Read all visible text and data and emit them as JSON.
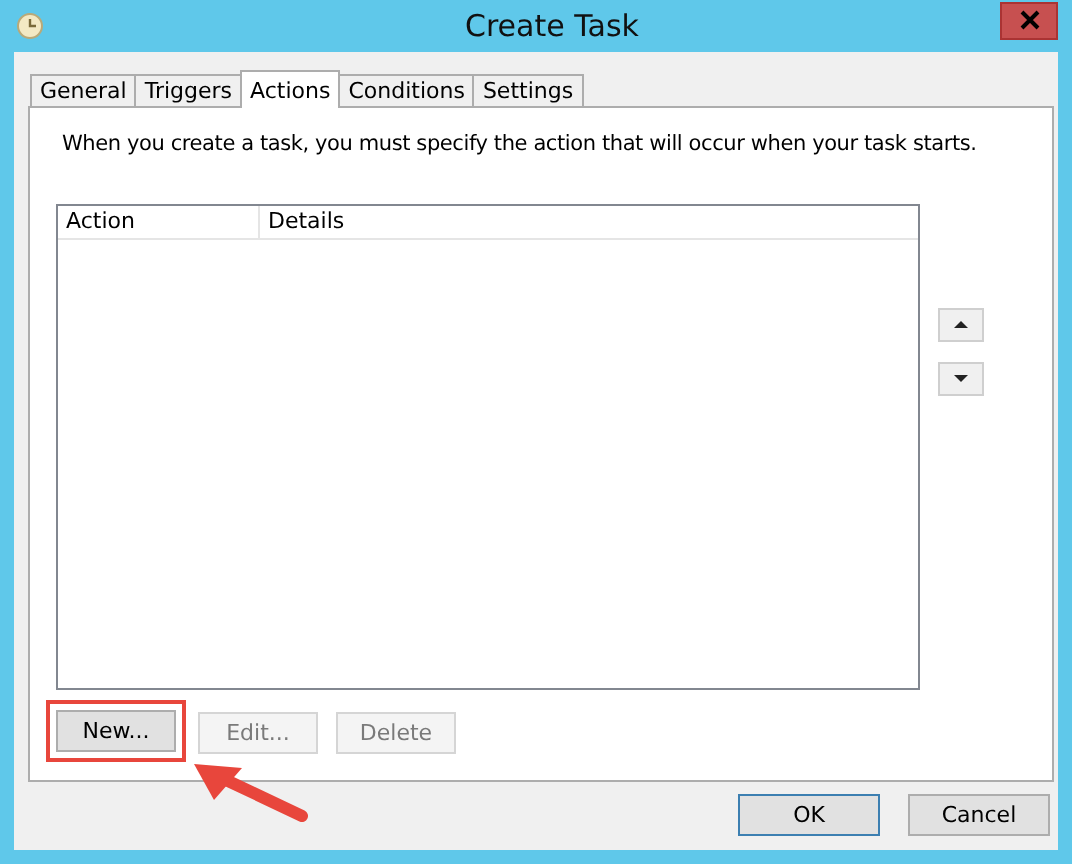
{
  "window": {
    "title": "Create Task"
  },
  "tabs": [
    {
      "label": "General",
      "selected": false
    },
    {
      "label": "Triggers",
      "selected": false
    },
    {
      "label": "Actions",
      "selected": true
    },
    {
      "label": "Conditions",
      "selected": false
    },
    {
      "label": "Settings",
      "selected": false
    }
  ],
  "description": "When you create a task, you must specify the action that will occur when your task starts.",
  "action_list": {
    "columns": [
      "Action",
      "Details"
    ]
  },
  "move_buttons": [
    {
      "kind": "up"
    },
    {
      "kind": "down"
    }
  ],
  "list_buttons": [
    {
      "label": "New...",
      "disabled": false,
      "highlighted": true
    },
    {
      "label": "Edit...",
      "disabled": true,
      "highlighted": false
    },
    {
      "label": "Delete",
      "disabled": true,
      "highlighted": false
    }
  ],
  "dialog_buttons": [
    {
      "label": "OK",
      "default": true
    },
    {
      "label": "Cancel",
      "default": false
    }
  ]
}
